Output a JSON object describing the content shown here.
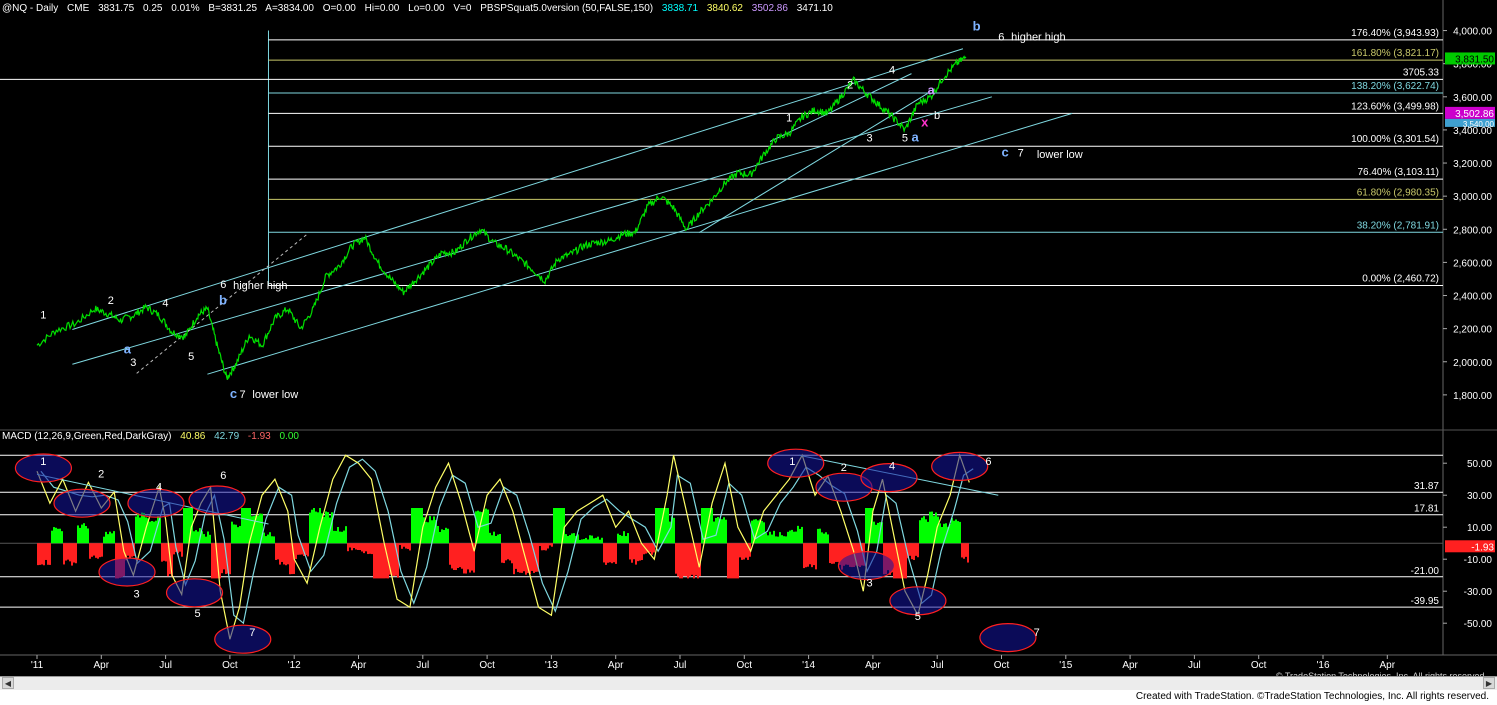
{
  "header": {
    "symbol": "@NQ - Daily",
    "exchange": "CME",
    "last": "3831.75",
    "change": "0.25",
    "pct": "0.01%",
    "bid": "B=3831.25",
    "ask": "A=3834.00",
    "open": "O=0.00",
    "hi": "Hi=0.00",
    "lo": "Lo=0.00",
    "vol": "V=0",
    "study": "PBSPSquat5.0version (50,FALSE,150)",
    "v1": "3838.71",
    "v2": "3840.62",
    "v3": "3502.86",
    "v4": "3471.10",
    "colors": {
      "v1": "#00ffff",
      "v2": "#ffff66",
      "v3": "#cc99ff",
      "v4": "#ffffff"
    }
  },
  "macd_header": {
    "label": "MACD (12,26,9,Green,Red,DarkGray)",
    "macd": "40.86",
    "avg": "42.79",
    "diff": "-1.93",
    "zero": "0.00"
  },
  "footer": {
    "created": "Created with TradeStation. ©TradeStation Technologies, Inc. All rights reserved.",
    "copyright": "© TradeStation Technologies, Inc. All rights reserved."
  },
  "chart_data": {
    "type": "line",
    "title": "@NQ - Daily",
    "price_axis": {
      "ylim": [
        1600,
        4100
      ],
      "ticks": [
        "4,000.00",
        "3,800.00",
        "3,600.00",
        "3,400.00",
        "3,200.00",
        "3,000.00",
        "2,800.00",
        "2,600.00",
        "2,400.00",
        "2,200.00",
        "2,000.00",
        "1,800.00"
      ],
      "tick_values": [
        4000,
        3800,
        3600,
        3400,
        3200,
        3000,
        2800,
        2600,
        2400,
        2200,
        2000,
        1800
      ],
      "last_price_label": "3,831.50",
      "marker_label": "3,502.86",
      "marker_label2": "3,540.00"
    },
    "macd_axis": {
      "ylim": [
        -68,
        62
      ],
      "ticks": [
        "50.00",
        "30.00",
        "10.00",
        "-10.00",
        "-30.00",
        "-50.00"
      ],
      "tick_values": [
        50,
        30,
        10,
        -10,
        -30,
        -50
      ],
      "level_labels": [
        "31.87",
        "17.81",
        "-21.00",
        "-39.95"
      ],
      "level_values": [
        31.87,
        17.81,
        -21.0,
        -39.95
      ],
      "last_value_label": "-1.93"
    },
    "x_labels": [
      "'11",
      "Apr",
      "Jul",
      "Oct",
      "'12",
      "Apr",
      "Jul",
      "Oct",
      "'13",
      "Apr",
      "Jul",
      "Oct",
      "'14",
      "Apr",
      "Jul",
      "Oct",
      "'15",
      "Apr",
      "Jul",
      "Oct",
      "'16",
      "Apr"
    ],
    "x_index": [
      0,
      1,
      2,
      3,
      4,
      5,
      6,
      7,
      8,
      9,
      10,
      11,
      12,
      13,
      14,
      15,
      16,
      17,
      18,
      19,
      20,
      21
    ],
    "fib_levels": [
      {
        "label": "176.40% (3,943.93)",
        "value": 3943.93,
        "color": "#ffffff"
      },
      {
        "label": "161.80% (3,821.17)",
        "value": 3821.17,
        "color": "#c8c86a"
      },
      {
        "label": "3705.33",
        "value": 3705.33,
        "color": "#ffffff"
      },
      {
        "label": "138.20% (3,622.74)",
        "value": 3622.74,
        "color": "#7fd8e0"
      },
      {
        "label": "123.60% (3,499.98)",
        "value": 3499.98,
        "color": "#ffffff"
      },
      {
        "label": "100.00% (3,301.54)",
        "value": 3301.54,
        "color": "#ffffff"
      },
      {
        "label": "76.40% (3,103.11)",
        "value": 3103.11,
        "color": "#ffffff"
      },
      {
        "label": "61.80% (2,980.35)",
        "value": 2980.35,
        "color": "#c8c86a"
      },
      {
        "label": "38.20% (2,781.91)",
        "value": 2781.91,
        "color": "#7fd8e0"
      },
      {
        "label": "0.00% (2,460.72)",
        "value": 2460.72,
        "color": "#ffffff"
      }
    ],
    "price_series": [
      [
        0.0,
        2100
      ],
      [
        0.3,
        2190
      ],
      [
        0.6,
        2230
      ],
      [
        0.9,
        2320
      ],
      [
        1.1,
        2290
      ],
      [
        1.3,
        2250
      ],
      [
        1.5,
        2280
      ],
      [
        1.7,
        2330
      ],
      [
        1.9,
        2280
      ],
      [
        2.1,
        2180
      ],
      [
        2.3,
        2150
      ],
      [
        2.5,
        2280
      ],
      [
        2.65,
        2320
      ],
      [
        2.8,
        2100
      ],
      [
        2.95,
        1900
      ],
      [
        3.1,
        1990
      ],
      [
        3.3,
        2160
      ],
      [
        3.5,
        2100
      ],
      [
        3.7,
        2260
      ],
      [
        3.9,
        2320
      ],
      [
        4.1,
        2200
      ],
      [
        4.3,
        2320
      ],
      [
        4.5,
        2520
      ],
      [
        4.7,
        2580
      ],
      [
        4.9,
        2700
      ],
      [
        5.1,
        2750
      ],
      [
        5.3,
        2600
      ],
      [
        5.5,
        2500
      ],
      [
        5.7,
        2420
      ],
      [
        5.9,
        2500
      ],
      [
        6.1,
        2580
      ],
      [
        6.3,
        2660
      ],
      [
        6.5,
        2660
      ],
      [
        6.7,
        2740
      ],
      [
        6.9,
        2800
      ],
      [
        7.1,
        2720
      ],
      [
        7.3,
        2680
      ],
      [
        7.5,
        2620
      ],
      [
        7.7,
        2560
      ],
      [
        7.9,
        2490
      ],
      [
        8.1,
        2620
      ],
      [
        8.3,
        2650
      ],
      [
        8.5,
        2700
      ],
      [
        8.7,
        2720
      ],
      [
        8.9,
        2730
      ],
      [
        9.1,
        2770
      ],
      [
        9.3,
        2780
      ],
      [
        9.5,
        2940
      ],
      [
        9.7,
        3000
      ],
      [
        9.9,
        2930
      ],
      [
        10.1,
        2800
      ],
      [
        10.3,
        2900
      ],
      [
        10.5,
        2980
      ],
      [
        10.7,
        3080
      ],
      [
        10.9,
        3140
      ],
      [
        11.1,
        3130
      ],
      [
        11.3,
        3250
      ],
      [
        11.5,
        3350
      ],
      [
        11.7,
        3380
      ],
      [
        11.9,
        3480
      ],
      [
        12.1,
        3520
      ],
      [
        12.3,
        3500
      ],
      [
        12.5,
        3600
      ],
      [
        12.7,
        3700
      ],
      [
        12.9,
        3620
      ],
      [
        13.1,
        3550
      ],
      [
        13.3,
        3480
      ],
      [
        13.5,
        3400
      ],
      [
        13.7,
        3560
      ],
      [
        13.9,
        3600
      ],
      [
        14.1,
        3720
      ],
      [
        14.3,
        3800
      ],
      [
        14.45,
        3840
      ]
    ],
    "price_channels": [
      {
        "from": [
          0.55,
          2195
        ],
        "to": [
          14.4,
          3890
        ],
        "color": "#7fd8e0"
      },
      {
        "from": [
          0.55,
          1985
        ],
        "to": [
          14.85,
          3600
        ],
        "color": "#7fd8e0"
      },
      {
        "from": [
          2.65,
          1925
        ],
        "to": [
          16.1,
          3500
        ],
        "color": "#7fd8e0"
      },
      {
        "from": [
          10.3,
          2780
        ],
        "to": [
          13.85,
          3620
        ],
        "color": "#7fd8e0"
      },
      {
        "from": [
          11.4,
          3330
        ],
        "to": [
          13.6,
          3740
        ],
        "color": "#7fd8e0"
      }
    ],
    "diagonal_dashed": {
      "from": [
        1.55,
        1930
      ],
      "to": [
        4.2,
        2770
      ],
      "color": "#bbbbbb"
    },
    "vertical_marker_index": 3.6,
    "macd_series": [
      [
        0.0,
        45
      ],
      [
        0.2,
        25
      ],
      [
        0.4,
        40
      ],
      [
        0.6,
        20
      ],
      [
        0.8,
        38
      ],
      [
        1.0,
        22
      ],
      [
        1.2,
        32
      ],
      [
        1.35,
        -5
      ],
      [
        1.5,
        -20
      ],
      [
        1.7,
        10
      ],
      [
        1.9,
        35
      ],
      [
        2.0,
        15
      ],
      [
        2.1,
        -20
      ],
      [
        2.25,
        -32
      ],
      [
        2.4,
        10
      ],
      [
        2.55,
        25
      ],
      [
        2.7,
        35
      ],
      [
        2.85,
        -30
      ],
      [
        3.0,
        -60
      ],
      [
        3.15,
        -40
      ],
      [
        3.3,
        0
      ],
      [
        3.5,
        30
      ],
      [
        3.7,
        40
      ],
      [
        3.9,
        20
      ],
      [
        4.0,
        -10
      ],
      [
        4.2,
        -25
      ],
      [
        4.4,
        10
      ],
      [
        4.6,
        40
      ],
      [
        4.8,
        55
      ],
      [
        5.0,
        50
      ],
      [
        5.2,
        40
      ],
      [
        5.4,
        0
      ],
      [
        5.6,
        -35
      ],
      [
        5.8,
        -40
      ],
      [
        6.0,
        10
      ],
      [
        6.2,
        35
      ],
      [
        6.4,
        50
      ],
      [
        6.6,
        25
      ],
      [
        6.8,
        -5
      ],
      [
        7.0,
        30
      ],
      [
        7.2,
        40
      ],
      [
        7.4,
        20
      ],
      [
        7.6,
        -10
      ],
      [
        7.8,
        -40
      ],
      [
        8.0,
        -45
      ],
      [
        8.2,
        10
      ],
      [
        8.4,
        20
      ],
      [
        8.6,
        25
      ],
      [
        8.8,
        30
      ],
      [
        9.0,
        10
      ],
      [
        9.2,
        20
      ],
      [
        9.4,
        0
      ],
      [
        9.6,
        -10
      ],
      [
        9.8,
        30
      ],
      [
        9.9,
        55
      ],
      [
        10.1,
        20
      ],
      [
        10.3,
        -15
      ],
      [
        10.5,
        25
      ],
      [
        10.7,
        50
      ],
      [
        10.9,
        10
      ],
      [
        11.1,
        -5
      ],
      [
        11.3,
        20
      ],
      [
        11.5,
        30
      ],
      [
        11.7,
        40
      ],
      [
        11.9,
        55
      ],
      [
        12.1,
        30
      ],
      [
        12.3,
        42
      ],
      [
        12.5,
        20
      ],
      [
        12.7,
        -5
      ],
      [
        12.85,
        -30
      ],
      [
        13.0,
        20
      ],
      [
        13.15,
        40
      ],
      [
        13.3,
        10
      ],
      [
        13.5,
        -30
      ],
      [
        13.7,
        -45
      ],
      [
        13.85,
        -20
      ],
      [
        14.0,
        10
      ],
      [
        14.2,
        30
      ],
      [
        14.35,
        55
      ],
      [
        14.5,
        38
      ]
    ],
    "macd_histogram_sign": [
      1,
      1,
      1,
      -1,
      1,
      -1,
      1,
      -1,
      -1,
      1,
      1,
      -1,
      1,
      1,
      1,
      -1,
      -1,
      1,
      1,
      -1,
      1,
      1,
      1,
      -1,
      1,
      1,
      1,
      1,
      1,
      -1,
      1,
      1,
      1,
      1,
      1,
      -1,
      1,
      1,
      1,
      -1,
      -1,
      1,
      1,
      1,
      1
    ],
    "macd_trendlines": [
      {
        "from": [
          0.0,
          43
        ],
        "to": [
          3.6,
          12
        ],
        "color": "#7fd8e0"
      },
      {
        "from": [
          11.85,
          55
        ],
        "to": [
          14.95,
          30
        ],
        "color": "#7fd8e0"
      }
    ],
    "wave_labels": [
      {
        "text": "1",
        "at": [
          0.05,
          2260
        ],
        "color": "#ffffff"
      },
      {
        "text": "2",
        "at": [
          1.1,
          2350
        ],
        "color": "#ffffff"
      },
      {
        "text": "4",
        "at": [
          1.95,
          2335
        ],
        "color": "#ffffff"
      },
      {
        "text": "3",
        "at": [
          1.45,
          1975
        ],
        "color": "#ffffff"
      },
      {
        "text": "5",
        "at": [
          2.35,
          2010
        ],
        "color": "#ffffff"
      },
      {
        "text": "a",
        "at": [
          1.35,
          2050
        ],
        "color": "#7fb3ff"
      },
      {
        "text": "6",
        "at": [
          2.85,
          2445
        ],
        "color": "#ffffff"
      },
      {
        "text": "b",
        "at": [
          2.83,
          2345
        ],
        "color": "#7fb3ff"
      },
      {
        "text": "higher high",
        "at": [
          3.05,
          2440
        ],
        "color": "#ffffff"
      },
      {
        "text": "c",
        "at": [
          3.0,
          1780
        ],
        "color": "#7fb3ff"
      },
      {
        "text": "7",
        "at": [
          3.15,
          1780
        ],
        "color": "#ffffff"
      },
      {
        "text": "lower low",
        "at": [
          3.35,
          1780
        ],
        "color": "#ffffff"
      },
      {
        "text": "1",
        "at": [
          11.65,
          3450
        ],
        "color": "#ffffff"
      },
      {
        "text": "2",
        "at": [
          12.6,
          3650
        ],
        "color": "#ffffff"
      },
      {
        "text": "3",
        "at": [
          12.9,
          3330
        ],
        "color": "#ffffff"
      },
      {
        "text": "4",
        "at": [
          13.25,
          3740
        ],
        "color": "#ffffff"
      },
      {
        "text": "5",
        "at": [
          13.45,
          3330
        ],
        "color": "#ffffff"
      },
      {
        "text": "a",
        "at": [
          13.6,
          3330
        ],
        "color": "#7fb3ff"
      },
      {
        "text": "x",
        "at": [
          13.75,
          3420
        ],
        "color": "#ff33cc"
      },
      {
        "text": "b",
        "at": [
          13.95,
          3465
        ],
        "color": "#ffffff"
      },
      {
        "text": "a",
        "at": [
          13.85,
          3615
        ],
        "color": "#cc99ff"
      },
      {
        "text": "b",
        "at": [
          14.55,
          4000
        ],
        "color": "#7fb3ff"
      },
      {
        "text": "6",
        "at": [
          14.95,
          3940
        ],
        "color": "#ffffff"
      },
      {
        "text": "higher high",
        "at": [
          15.15,
          3940
        ],
        "color": "#ffffff"
      },
      {
        "text": "c",
        "at": [
          15.0,
          3240
        ],
        "color": "#7fb3ff"
      },
      {
        "text": "7",
        "at": [
          15.25,
          3240
        ],
        "color": "#ffffff"
      },
      {
        "text": "lower low",
        "at": [
          15.55,
          3230
        ],
        "color": "#ffffff"
      }
    ],
    "macd_labels": [
      {
        "text": "1",
        "at": [
          0.05,
          49
        ]
      },
      {
        "text": "2",
        "at": [
          0.95,
          41
        ]
      },
      {
        "text": "4",
        "at": [
          1.85,
          33
        ]
      },
      {
        "text": "3",
        "at": [
          1.5,
          -34
        ]
      },
      {
        "text": "5",
        "at": [
          2.45,
          -46
        ]
      },
      {
        "text": "6",
        "at": [
          2.85,
          40
        ]
      },
      {
        "text": "7",
        "at": [
          3.3,
          -58
        ]
      },
      {
        "text": "1",
        "at": [
          11.7,
          49
        ]
      },
      {
        "text": "2",
        "at": [
          12.5,
          45
        ]
      },
      {
        "text": "3",
        "at": [
          12.9,
          -27
        ]
      },
      {
        "text": "4",
        "at": [
          13.25,
          46
        ]
      },
      {
        "text": "5",
        "at": [
          13.65,
          -48
        ]
      },
      {
        "text": "6",
        "at": [
          14.75,
          49
        ]
      },
      {
        "text": "7",
        "at": [
          15.5,
          -58
        ]
      }
    ],
    "macd_ellipses": [
      {
        "at": [
          0.1,
          47
        ]
      },
      {
        "at": [
          0.7,
          25
        ]
      },
      {
        "at": [
          1.85,
          25
        ]
      },
      {
        "at": [
          1.4,
          -18
        ]
      },
      {
        "at": [
          2.8,
          27
        ]
      },
      {
        "at": [
          2.45,
          -31
        ]
      },
      {
        "at": [
          3.2,
          -60
        ]
      },
      {
        "at": [
          11.8,
          50
        ]
      },
      {
        "at": [
          12.55,
          35
        ]
      },
      {
        "at": [
          13.25,
          41
        ]
      },
      {
        "at": [
          12.9,
          -14
        ]
      },
      {
        "at": [
          13.7,
          -36
        ]
      },
      {
        "at": [
          14.35,
          48
        ]
      },
      {
        "at": [
          15.1,
          -59
        ]
      }
    ],
    "last_price_marker_index": 14.45
  }
}
